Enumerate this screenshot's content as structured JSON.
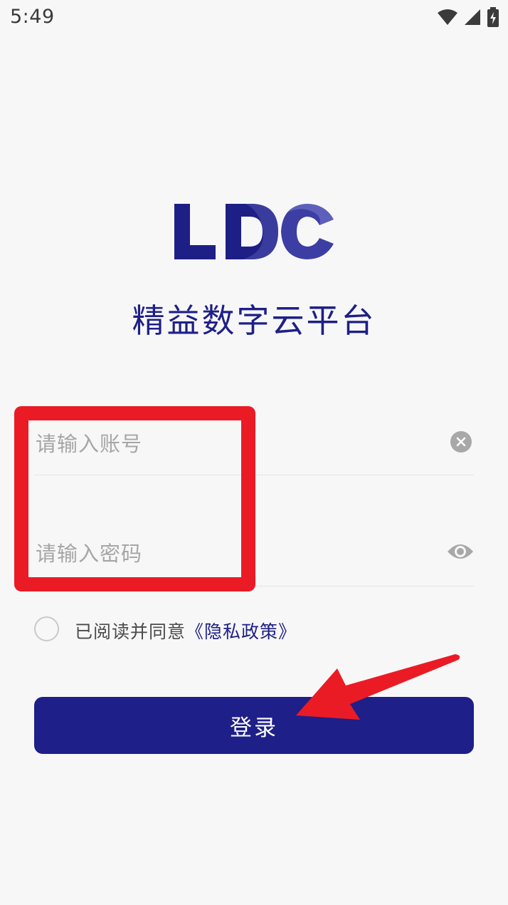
{
  "status_bar": {
    "time": "5:49"
  },
  "app": {
    "logo_text": "LDC",
    "title": "精益数字云平台"
  },
  "form": {
    "account_placeholder": "请输入账号",
    "password_placeholder": "请输入密码"
  },
  "privacy": {
    "prefix": "已阅读并同意",
    "link": "《隐私政策》"
  },
  "login": {
    "label": "登录"
  },
  "colors": {
    "brand": "#1e1f88",
    "highlight": "#ea1b25",
    "background": "#f7f7f8"
  },
  "icons": [
    "wifi-icon",
    "signal-icon",
    "battery-icon",
    "clear-icon",
    "eye-icon"
  ]
}
